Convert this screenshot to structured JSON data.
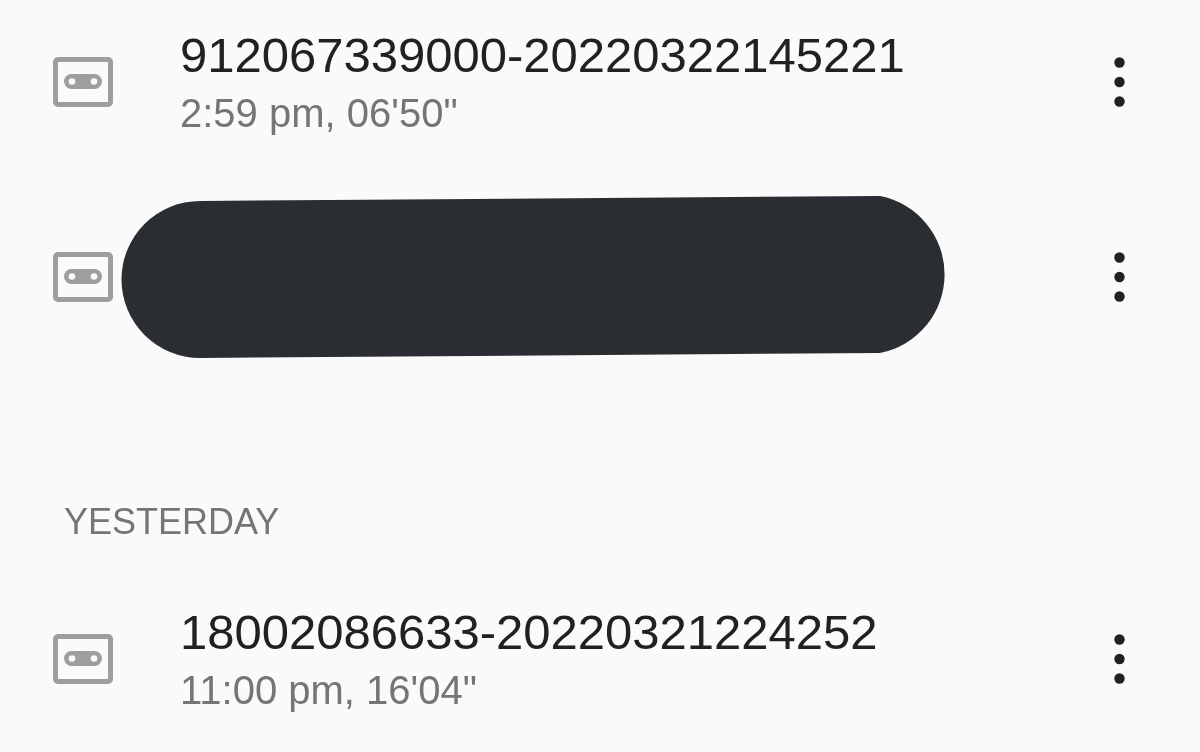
{
  "recordings_list": {
    "groups": [
      {
        "items": [
          {
            "kind": "recording",
            "title": "912067339000-20220322145221",
            "details": "2:59 pm, 06'50\""
          },
          {
            "kind": "redacted"
          }
        ]
      },
      {
        "heading": "YESTERDAY",
        "items": [
          {
            "kind": "recording",
            "title": "18002086633-20220321224252",
            "details": "11:00 pm, 16'04\""
          }
        ]
      }
    ]
  }
}
